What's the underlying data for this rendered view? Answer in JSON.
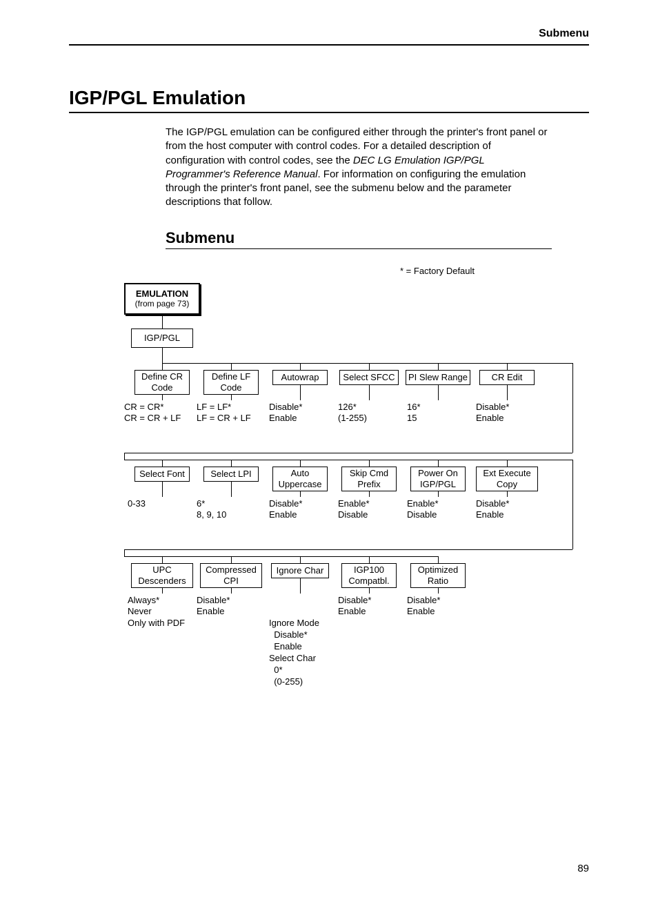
{
  "header": {
    "label": "Submenu"
  },
  "title": "IGP/PGL Emulation",
  "paragraph": {
    "p1": "The IGP/PGL emulation can be configured either through the printer's front panel or from the host computer with control codes. For a detailed description of configuration with control codes, see the ",
    "p1_italic": "DEC LG Emulation IGP/PGL Programmer's Reference Manual",
    "p1_tail": ". For information on configuring the emulation through the printer's front panel, see the submenu below and the parameter descriptions that follow."
  },
  "subhead": "Submenu",
  "legend": "* = Factory Default",
  "root": {
    "l1": "EMULATION",
    "l2": "(from page 73)"
  },
  "igp": "IGP/PGL",
  "row1": {
    "c1": {
      "t1": "Define CR",
      "t2": "Code",
      "v1": "CR = CR*",
      "v2": "CR = CR + LF"
    },
    "c2": {
      "t1": "Define LF",
      "t2": "Code",
      "v1": "LF = LF*",
      "v2": "LF = CR + LF"
    },
    "c3": {
      "t1": "Autowrap",
      "v1": "Disable*",
      "v2": "Enable"
    },
    "c4": {
      "t1": "Select SFCC",
      "v1": "126*",
      "v2": "(1-255)"
    },
    "c5": {
      "t1": "PI Slew Range",
      "v1": "16*",
      "v2": "15"
    },
    "c6": {
      "t1": "CR Edit",
      "v1": "Disable*",
      "v2": "Enable"
    }
  },
  "row2": {
    "c1": {
      "t1": "Select Font",
      "v1": "0-33"
    },
    "c2": {
      "t1": "Select LPI",
      "v1": "6*",
      "v2": "8, 9, 10"
    },
    "c3": {
      "t1": "Auto",
      "t2": "Uppercase",
      "v1": "Disable*",
      "v2": "Enable"
    },
    "c4": {
      "t1": "Skip Cmd",
      "t2": "Prefix",
      "v1": "Enable*",
      "v2": "Disable"
    },
    "c5": {
      "t1": "Power On",
      "t2": "IGP/PGL",
      "v1": "Enable*",
      "v2": "Disable"
    },
    "c6": {
      "t1": "Ext Execute",
      "t2": "Copy",
      "v1": "Disable*",
      "v2": "Enable"
    }
  },
  "row3": {
    "c1": {
      "t1": "UPC",
      "t2": "Descenders",
      "v1": "Always*",
      "v2": "Never",
      "v3": "Only with PDF"
    },
    "c2": {
      "t1": "Compressed",
      "t2": "CPI",
      "v1": "Disable*",
      "v2": "Enable"
    },
    "c3": {
      "t1": "Ignore Char",
      "v1": "Ignore Mode",
      "v2": "  Disable*",
      "v3": "  Enable",
      "v4": "Select Char",
      "v5": "  0*",
      "v6": "  (0-255)"
    },
    "c4": {
      "t1": "IGP100",
      "t2": "Compatbl.",
      "v1": "Disable*",
      "v2": "Enable"
    },
    "c5": {
      "t1": "Optimized",
      "t2": "Ratio",
      "v1": "Disable*",
      "v2": "Enable"
    }
  },
  "pagenum": "89"
}
